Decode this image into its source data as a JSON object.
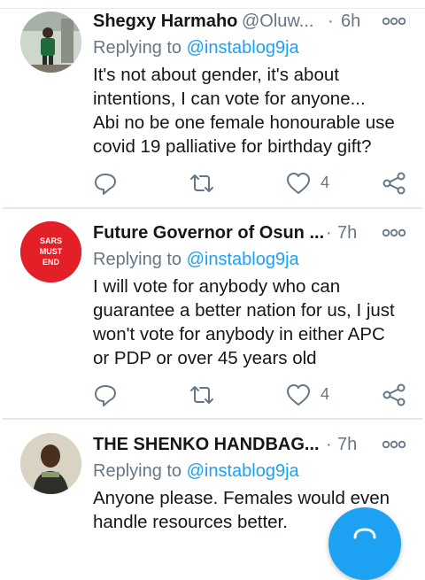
{
  "tweets": [
    {
      "name": "Shegxy Harmaho",
      "handle": "@Oluw...",
      "time": "6h",
      "replying_prefix": "Replying to ",
      "replying_to": "@instablog9ja",
      "body_lines": [
        "It's not about gender, it's about",
        "intentions, I can vote for anyone...",
        "Abi no be one female honourable use",
        "covid 19 palliative for birthday gift?"
      ],
      "likes": "4",
      "avatar_icon": "person-photo"
    },
    {
      "name": "Future Governor of Osun ...",
      "time": "7h",
      "replying_prefix": "Replying to ",
      "replying_to": "@instablog9ja",
      "body_lines": [
        "I will vote for anybody who can",
        "guarantee a better nation for us, I just",
        "won't vote for anybody in either APC",
        "or PDP or over 45 years old"
      ],
      "likes": "4",
      "avatar_text": [
        "SARS",
        "MUST",
        "END"
      ],
      "avatar_color": "#e32027"
    },
    {
      "name": "THE SHENKO HANDBAG...",
      "time": "7h",
      "replying_prefix": "Replying to ",
      "replying_to": "@instablog9ja",
      "body_lines": [
        "Anyone please. Females would even",
        "handle resources better."
      ],
      "avatar_icon": "person-photo"
    }
  ],
  "dot_separator": "·",
  "colors": {
    "accent": "#1da1f2",
    "secondary_text": "#657786",
    "primary_text": "#14171a"
  },
  "compose_button_icon": "compose-icon"
}
